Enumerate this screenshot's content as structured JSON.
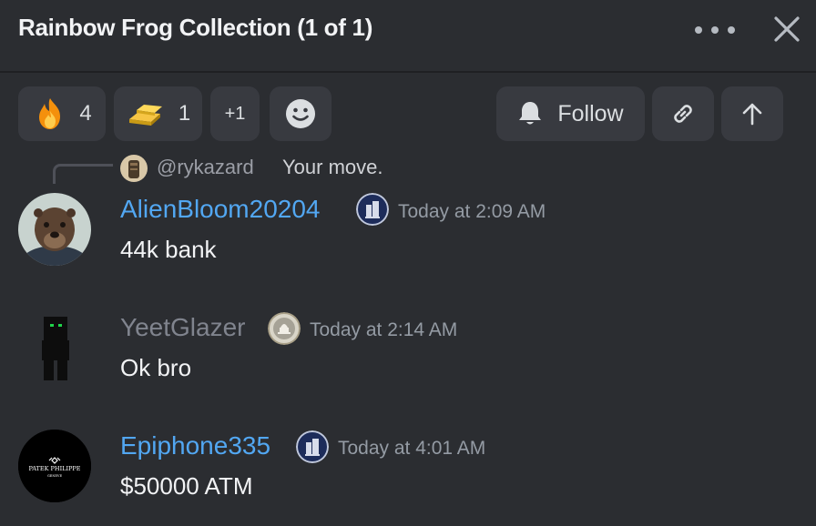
{
  "header": {
    "title": "Rainbow Frog Collection (1 of 1)",
    "more_icon": "more-horizontal-icon",
    "close_icon": "close-icon"
  },
  "reactions": [
    {
      "emoji": "fire-emoji",
      "count": "4"
    },
    {
      "emoji": "gold-bars-emoji",
      "count": "1"
    },
    {
      "emoji": "",
      "count": "+1"
    }
  ],
  "toolbar": {
    "add_reaction_icon": "smiley-icon",
    "follow_label": "Follow",
    "follow_icon": "bell-icon",
    "copy_link_icon": "link-icon",
    "scroll_up_icon": "arrow-up-icon"
  },
  "reply": {
    "author": "@rykazard",
    "text": "Your move."
  },
  "messages": [
    {
      "username": "AlienBloom20204",
      "username_color": "#52a7f2",
      "badge": "building-badge-icon",
      "timestamp": "Today at 2:09 AM",
      "text": "44k bank"
    },
    {
      "username": "YeetGlazer",
      "username_color": "#80848e",
      "badge": "capitol-badge-icon",
      "timestamp": "Today at 2:14 AM",
      "text": "Ok bro"
    },
    {
      "username": "Epiphone335",
      "username_color": "#52a7f2",
      "badge": "building-badge-icon",
      "timestamp": "Today at 4:01 AM",
      "text": "$50000 ATM"
    }
  ],
  "avatar_logo": {
    "brand": "PATEK PHILIPPE",
    "sub": "GENEVE"
  },
  "colors": {
    "background": "#2b2d31",
    "pill": "#383a40",
    "link_blue": "#52a7f2",
    "muted_name": "#80848e"
  }
}
